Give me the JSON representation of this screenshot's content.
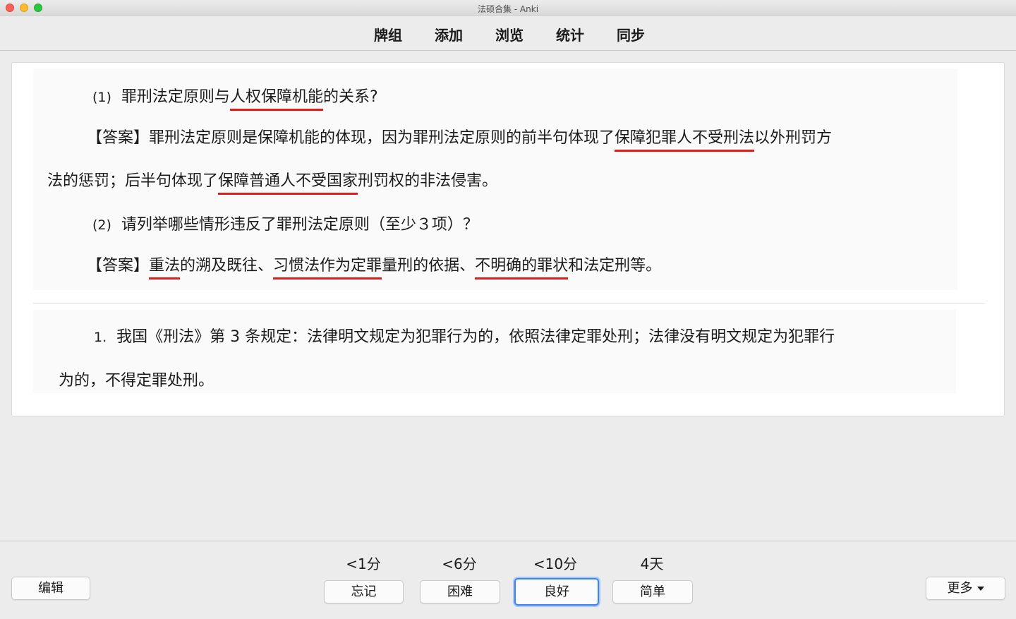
{
  "window": {
    "title": "法硕合集 - Anki"
  },
  "toolbar": {
    "items": [
      "牌组",
      "添加",
      "浏览",
      "统计",
      "同步"
    ]
  },
  "card": {
    "q1_num": "(1)",
    "q1_a": "罪刑法定原则与",
    "q1_u": "人权保障机能",
    "q1_b": "的关系?",
    "a1_a": "【答案】罪刑法定原则是保障机能的体现，因为罪刑法定原则的前半句体现了",
    "a1_u": "保障犯罪人不受刑法",
    "a1_b": "以外刑罚方",
    "a1_c": "法的惩罚；后半句体现了",
    "a1_u2": "保障普通人不受国家",
    "a1_d": "刑罚权的非法侵害。",
    "q2_num": "(2)",
    "q2_text": "请列举哪些情形违反了罪刑法定原则（至少３项）？",
    "a2_a": "【答案】",
    "a2_u1": "重法",
    "a2_b": "的溯及既往、",
    "a2_u2": "习惯法作为定罪",
    "a2_c": "量刑的依据、",
    "a2_u3": "不明确的罪状",
    "a2_d": "和法定刑等。",
    "n_num": "1.",
    "n_text": "我国《刑法》第 3 条规定：法律明文规定为犯罪行为的，依照法律定罪处刑；法律没有明文规定为犯罪行",
    "n_text2": "为的，不得定罪处刑。"
  },
  "bottom": {
    "edit": "编辑",
    "more": "更多",
    "answers": [
      {
        "due": "<1分",
        "label": "忘记"
      },
      {
        "due": "<6分",
        "label": "困难"
      },
      {
        "due": "<10分",
        "label": "良好"
      },
      {
        "due": "4天",
        "label": "简单"
      }
    ],
    "accent": "#3b82f7",
    "underline_color": "#e21b1b"
  }
}
